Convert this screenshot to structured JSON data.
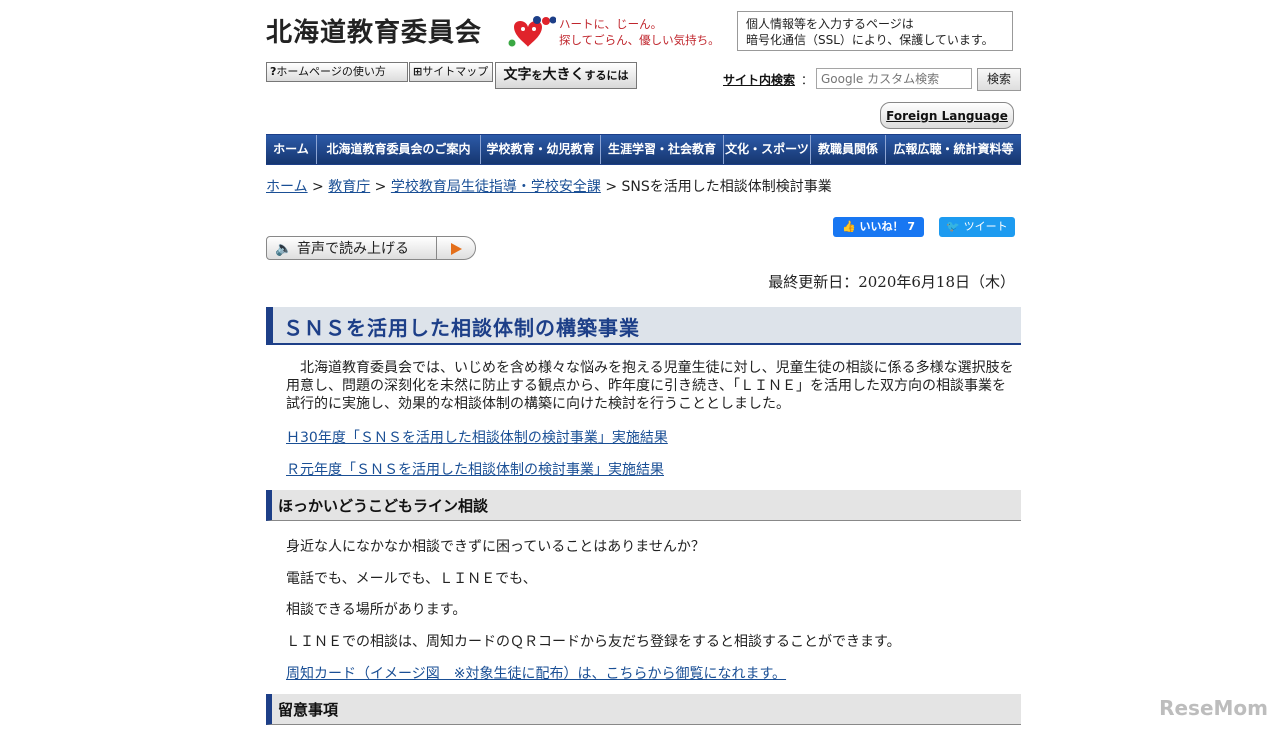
{
  "header": {
    "site_title": "北海道教育委員会",
    "tagline_1": "ハートに、じーん。",
    "tagline_2": "探してごらん、優しい気持ち。",
    "ssl_line_1": "個人情報等を入力するページは",
    "ssl_line_2": "暗号化通信（SSL）により、保護しています。",
    "howto_label": "ホームページの使い方",
    "sitemap_label": "サイトマップ",
    "bigtext_label_a": "文字",
    "bigtext_label_b": "を",
    "bigtext_label_c": "大きく",
    "bigtext_label_d": "するには",
    "search_label": "サイト内検索",
    "search_colon": "：",
    "search_placeholder": "Google カスタム検索",
    "search_button": "検索",
    "foreign_language": "Foreign Language"
  },
  "nav": {
    "items": [
      {
        "label": "ホーム"
      },
      {
        "label": "北海道教育委員会のご案内"
      },
      {
        "label": "学校教育・幼児教育"
      },
      {
        "label": "生涯学習・社会教育"
      },
      {
        "label": "文化・スポーツ"
      },
      {
        "label": "教職員関係"
      },
      {
        "label": "広報広聴・統計資料等"
      }
    ]
  },
  "breadcrumb": {
    "home": "ホーム",
    "sep": " > ",
    "level1": "教育庁",
    "level2": "学校教育局生徒指導・学校安全課",
    "current": "SNSを活用した相談体制検討事業"
  },
  "social": {
    "like": "いいね！ 7",
    "tweet": "ツイート"
  },
  "speech": {
    "label": "音声で読み上げる"
  },
  "updated": "最終更新日：2020年6月18日（木）",
  "main": {
    "title": "ＳＮＳを活用した相談体制の構築事業",
    "intro": "　北海道教育委員会では、いじめを含め様々な悩みを抱える児童生徒に対し、児童生徒の相談に係る多様な選択肢を用意し、問題の深刻化を未然に防止する観点から、昨年度に引き続き、「ＬＩＮＥ」を活用した双方向の相談事業を試行的に実施し、効果的な相談体制の構築に向けた検討を行うこととしました。",
    "link_h30": "Ｈ30年度「ＳＮＳを活用した相談体制の検討事業」実施結果",
    "link_r1": "Ｒ元年度「ＳＮＳを活用した相談体制の検討事業」実施結果",
    "section1_title": "ほっかいどうこどもライン相談",
    "s1_line1": "身近な人になかなか相談できずに困っていることはありませんか？",
    "s1_line2": "電話でも、メールでも、ＬＩＮＥでも、",
    "s1_line3": "相談できる場所があります。",
    "s1_line4": "ＬＩＮＥでの相談は、周知カードのＱＲコードから友だち登録をすると相談することができます。",
    "s1_link": "周知カード（イメージ図　※対象生徒に配布）は、こちらから御覧になれます。",
    "section2_title": "留意事項"
  },
  "watermark": "ReseMom"
}
